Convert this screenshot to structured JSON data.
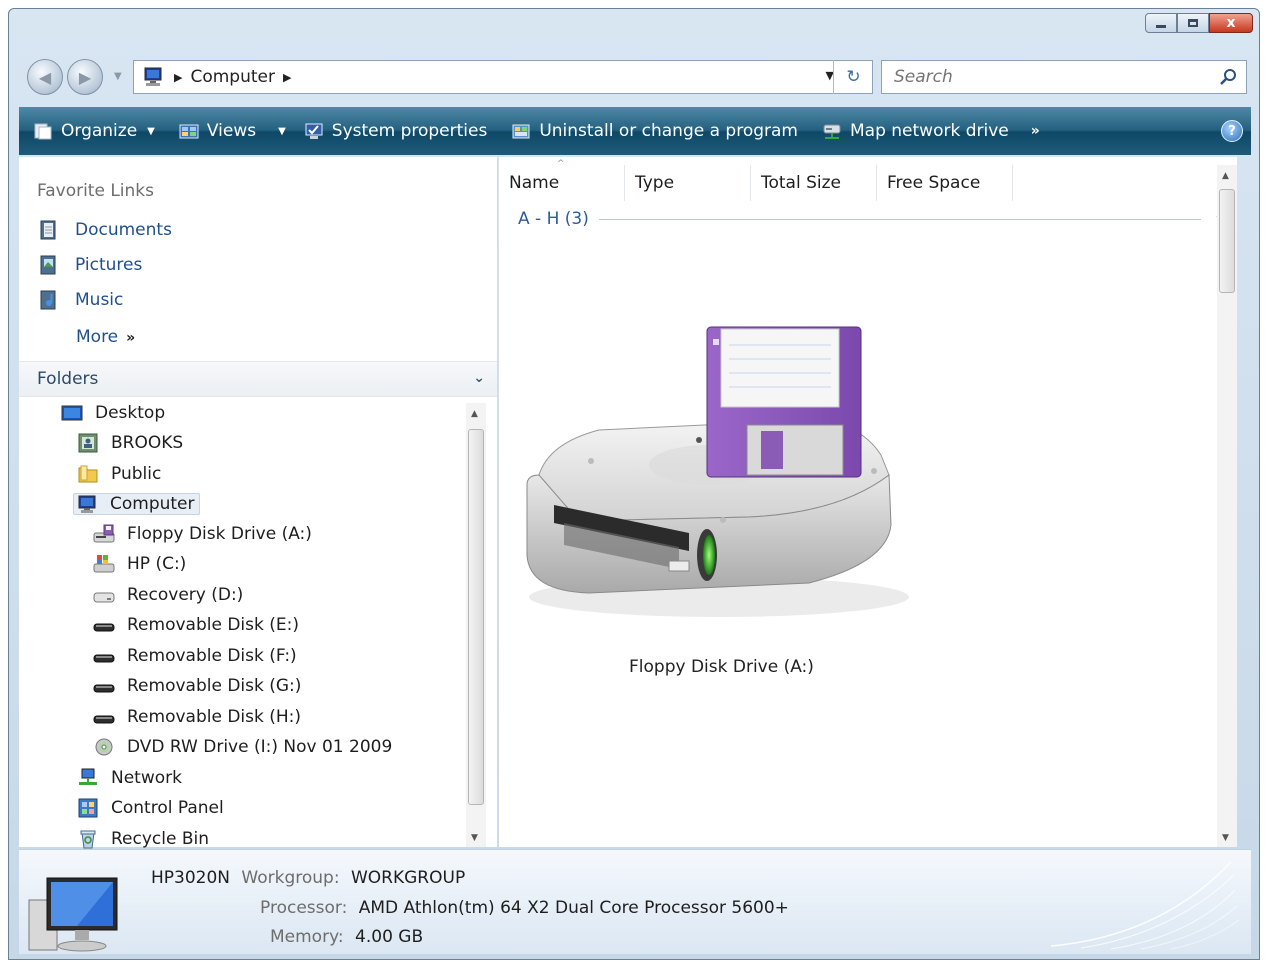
{
  "window": {
    "caption": {
      "minimize": "–",
      "maximize": "□",
      "close": "x"
    }
  },
  "address": {
    "location": "Computer",
    "search_placeholder": "Search"
  },
  "command_bar": {
    "organize": "Organize",
    "views": "Views",
    "system_properties": "System properties",
    "uninstall": "Uninstall or change a program",
    "map_drive": "Map network drive",
    "more": "»",
    "help": "?"
  },
  "nav": {
    "favorite_links_header": "Favorite Links",
    "favorites": [
      "Documents",
      "Pictures",
      "Music"
    ],
    "more": "More",
    "more_glyph": "»",
    "folders_header": "Folders",
    "tree": [
      "Desktop",
      "BROOKS",
      "Public",
      "Computer",
      "Floppy Disk Drive (A:)",
      "HP (C:)",
      "Recovery (D:)",
      "Removable Disk (E:)",
      "Removable Disk (F:)",
      "Removable Disk (G:)",
      "Removable Disk (H:)",
      "DVD RW Drive (I:) Nov 01 2009",
      "Network",
      "Control Panel",
      "Recycle Bin"
    ]
  },
  "content": {
    "columns": [
      "Name",
      "Type",
      "Total Size",
      "Free Space"
    ],
    "group": "A - H (3)",
    "items": [
      {
        "label": "Floppy Disk Drive (A:)",
        "icon": "floppy-drive-icon"
      }
    ]
  },
  "details": {
    "computer_name": "HP3020N",
    "workgroup_label": "Workgroup:",
    "workgroup": "WORKGROUP",
    "processor_label": "Processor:",
    "processor": "AMD Athlon(tm) 64 X2 Dual Core Processor 5600+",
    "memory_label": "Memory:",
    "memory": "4.00 GB"
  },
  "colors": {
    "command_bar": "#1f5a79",
    "link_blue": "#1f4f8f",
    "group_blue": "#2e5c9a",
    "floppy_purple": "#8b5cb5"
  }
}
